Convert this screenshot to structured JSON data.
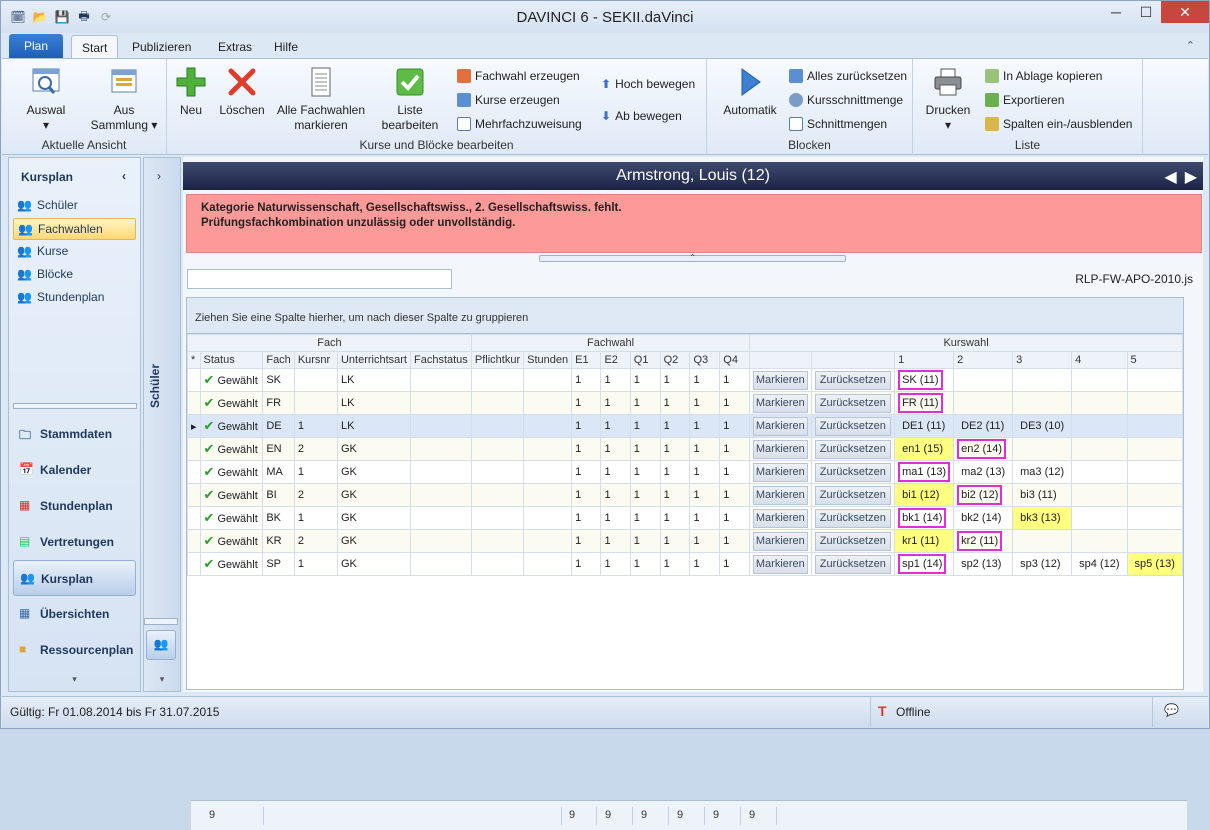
{
  "window": {
    "title": "DAVINCI 6 - SEKII.daVinci"
  },
  "tabs": {
    "plan": "Plan",
    "start": "Start",
    "publish": "Publizieren",
    "extras": "Extras",
    "help": "Hilfe"
  },
  "ribbon": {
    "view": {
      "select": "Auswal",
      "from_collection": "Aus",
      "from_collection2": "Sammlung",
      "group": "Aktuelle Ansicht"
    },
    "edit": {
      "new": "Neu",
      "delete": "Löschen",
      "mark_all": "Alle Fachwahlen",
      "mark_all2": "markieren",
      "edit_list": "Liste",
      "edit_list2": "bearbeiten",
      "create_fachwahl": "Fachwahl erzeugen",
      "create_courses": "Kurse erzeugen",
      "multi_assign": "Mehrfachzuweisung",
      "move_up": "Hoch bewegen",
      "move_down": "Ab bewegen",
      "group": "Kurse und Blöcke bearbeiten"
    },
    "blocks": {
      "auto": "Automatik",
      "reset_all": "Alles zurücksetzen",
      "course_intersect": "Kursschnittmenge",
      "intersections": "Schnittmengen",
      "group": "Blocken"
    },
    "list": {
      "print": "Drucken",
      "copy": "In Ablage kopieren",
      "export": "Exportieren",
      "columns": "Spalten ein-/ausblenden",
      "group": "Liste"
    }
  },
  "sidebar": {
    "title": "Kursplan",
    "items": [
      {
        "label": "Schüler"
      },
      {
        "label": "Fachwahlen"
      },
      {
        "label": "Kurse"
      },
      {
        "label": "Blöcke"
      },
      {
        "label": "Stundenplan"
      }
    ],
    "modules": [
      {
        "label": "Stammdaten"
      },
      {
        "label": "Kalender"
      },
      {
        "label": "Stundenplan"
      },
      {
        "label": "Vertretungen"
      },
      {
        "label": "Kursplan"
      },
      {
        "label": "Übersichten"
      },
      {
        "label": "Ressourcenplan"
      }
    ],
    "collapsed_label": "Schüler"
  },
  "main": {
    "student": "Armstrong, Louis (12)",
    "error_line1": "Kategorie Naturwissenschaft, Gesellschaftswiss., 2. Gesellschaftswiss. fehlt.",
    "error_line2": "Prüfungsfachkombination unzulässig oder unvollständig.",
    "rule_file": "RLP-FW-APO-2010.js",
    "group_hint": "Ziehen Sie eine Spalte hierher, um nach dieser Spalte zu gruppieren"
  },
  "grid": {
    "bands": {
      "fach": "Fach",
      "fachwahl": "Fachwahl",
      "kurswahl": "Kurswahl"
    },
    "columns": [
      "Status",
      "Fach",
      "Kursnr",
      "Unterrichtsart",
      "Fachstatus",
      "Pflichtkur",
      "Stunden",
      "E1",
      "E2",
      "Q1",
      "Q2",
      "Q3",
      "Q4",
      "1",
      "2",
      "3",
      "4",
      "5"
    ],
    "button_mark": "Markieren",
    "button_reset": "Zurücksetzen",
    "rows": [
      {
        "status": "Gewählt",
        "fach": "SK",
        "kursnr": "",
        "art": "LK",
        "e1": "1",
        "e2": "1",
        "q1": "1",
        "q2": "1",
        "q3": "1",
        "q4": "1",
        "k": [
          {
            "t": "SK (11)",
            "m": 1
          },
          {
            "t": ""
          },
          {
            "t": ""
          },
          {
            "t": ""
          },
          {
            "t": ""
          }
        ]
      },
      {
        "status": "Gewählt",
        "fach": "FR",
        "kursnr": "",
        "art": "LK",
        "e1": "1",
        "e2": "1",
        "q1": "1",
        "q2": "1",
        "q3": "1",
        "q4": "1",
        "k": [
          {
            "t": "FR (11)",
            "m": 1
          },
          {
            "t": ""
          },
          {
            "t": ""
          },
          {
            "t": ""
          },
          {
            "t": ""
          }
        ]
      },
      {
        "status": "Gewählt",
        "fach": "DE",
        "kursnr": "1",
        "art": "LK",
        "e1": "1",
        "e2": "1",
        "q1": "1",
        "q2": "1",
        "q3": "1",
        "q4": "1",
        "k": [
          {
            "t": "DE1 (11)"
          },
          {
            "t": "DE2 (11)"
          },
          {
            "t": "DE3 (10)"
          },
          {
            "t": ""
          },
          {
            "t": ""
          }
        ]
      },
      {
        "status": "Gewählt",
        "fach": "EN",
        "kursnr": "2",
        "art": "GK",
        "e1": "1",
        "e2": "1",
        "q1": "1",
        "q2": "1",
        "q3": "1",
        "q4": "1",
        "k": [
          {
            "t": "en1 (15)",
            "y": 1
          },
          {
            "t": "en2 (14)",
            "m": 1
          },
          {
            "t": ""
          },
          {
            "t": ""
          },
          {
            "t": ""
          }
        ]
      },
      {
        "status": "Gewählt",
        "fach": "MA",
        "kursnr": "1",
        "art": "GK",
        "e1": "1",
        "e2": "1",
        "q1": "1",
        "q2": "1",
        "q3": "1",
        "q4": "1",
        "k": [
          {
            "t": "ma1 (13)",
            "m": 1
          },
          {
            "t": "ma2 (13)"
          },
          {
            "t": "ma3 (12)"
          },
          {
            "t": ""
          },
          {
            "t": ""
          }
        ]
      },
      {
        "status": "Gewählt",
        "fach": "BI",
        "kursnr": "2",
        "art": "GK",
        "e1": "1",
        "e2": "1",
        "q1": "1",
        "q2": "1",
        "q3": "1",
        "q4": "1",
        "k": [
          {
            "t": "bi1 (12)",
            "y": 1
          },
          {
            "t": "bi2 (12)",
            "m": 1
          },
          {
            "t": "bi3 (11)"
          },
          {
            "t": ""
          },
          {
            "t": ""
          }
        ]
      },
      {
        "status": "Gewählt",
        "fach": "BK",
        "kursnr": "1",
        "art": "GK",
        "e1": "1",
        "e2": "1",
        "q1": "1",
        "q2": "1",
        "q3": "1",
        "q4": "1",
        "k": [
          {
            "t": "bk1 (14)",
            "m": 1
          },
          {
            "t": "bk2 (14)"
          },
          {
            "t": "bk3 (13)",
            "y": 1
          },
          {
            "t": ""
          },
          {
            "t": ""
          }
        ]
      },
      {
        "status": "Gewählt",
        "fach": "KR",
        "kursnr": "2",
        "art": "GK",
        "e1": "1",
        "e2": "1",
        "q1": "1",
        "q2": "1",
        "q3": "1",
        "q4": "1",
        "k": [
          {
            "t": "kr1 (11)",
            "y": 1
          },
          {
            "t": "kr2 (11)",
            "m": 1
          },
          {
            "t": ""
          },
          {
            "t": ""
          },
          {
            "t": ""
          }
        ]
      },
      {
        "status": "Gewählt",
        "fach": "SP",
        "kursnr": "1",
        "art": "GK",
        "e1": "1",
        "e2": "1",
        "q1": "1",
        "q2": "1",
        "q3": "1",
        "q4": "1",
        "k": [
          {
            "t": "sp1 (14)",
            "m": 1
          },
          {
            "t": "sp2 (13)"
          },
          {
            "t": "sp3 (12)"
          },
          {
            "t": "sp4 (12)"
          },
          {
            "t": "sp5 (13)",
            "y": 1
          }
        ]
      }
    ],
    "footer_totals": {
      "count": "9",
      "e1": "9",
      "e2": "9",
      "q1": "9",
      "q2": "9",
      "q3": "9",
      "q4": "9"
    }
  },
  "status": {
    "validity": "Gültig: Fr 01.08.2014 bis Fr 31.07.2015",
    "connection": "Offline"
  },
  "colors": {
    "error_bg": "#fb9a98",
    "highlight_yellow": "#ffff80",
    "highlight_magenta": "#e12fd6",
    "header_dark": "#1c2446"
  }
}
